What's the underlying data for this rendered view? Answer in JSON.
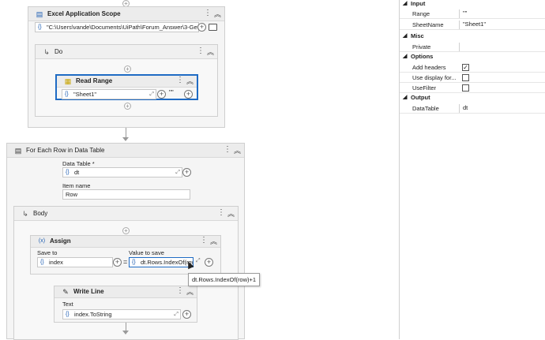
{
  "excel_scope": {
    "title": "Excel Application Scope",
    "path_value": "\"C:\\Users\\vande\\Documents\\UiPath\\Forum_Answer\\3-GetCe"
  },
  "do_seq": {
    "title": "Do"
  },
  "read_range": {
    "title": "Read Range",
    "sheet_value": "\"Sheet1\"",
    "range_dots": "\"\""
  },
  "for_each": {
    "title": "For Each Row in Data Table",
    "datatable_label": "Data Table *",
    "datatable_value": "dt",
    "item_label": "Item name",
    "item_value": "Row"
  },
  "body_seq": {
    "title": "Body"
  },
  "assign": {
    "title": "Assign",
    "save_label": "Save to",
    "value_label": "Value to save",
    "save_value": "index",
    "equals": "=",
    "value_value": "dt.Rows.IndexOf(row"
  },
  "tooltip": {
    "text": "dt.Rows.IndexOf(row)+1"
  },
  "write_line": {
    "title": "Write Line",
    "text_label": "Text",
    "text_value": "index.ToString"
  },
  "properties": {
    "sections": [
      {
        "name": "Input",
        "rows": [
          {
            "label": "Range",
            "value": "\"\""
          },
          {
            "label": "SheetName",
            "value": "\"Sheet1\""
          }
        ]
      },
      {
        "name": "Misc",
        "rows": [
          {
            "label": "Private",
            "value": ""
          }
        ]
      },
      {
        "name": "Options",
        "rows": [
          {
            "label": "Add headers",
            "checked": true
          },
          {
            "label": "Use display for...",
            "checked": false
          },
          {
            "label": "UseFilter",
            "checked": false
          }
        ]
      },
      {
        "name": "Output",
        "rows": [
          {
            "label": "DataTable",
            "value": "dt"
          }
        ]
      }
    ]
  },
  "colors": {
    "accent": "#1f6bc4",
    "card_bg": "#f5f5f5"
  }
}
